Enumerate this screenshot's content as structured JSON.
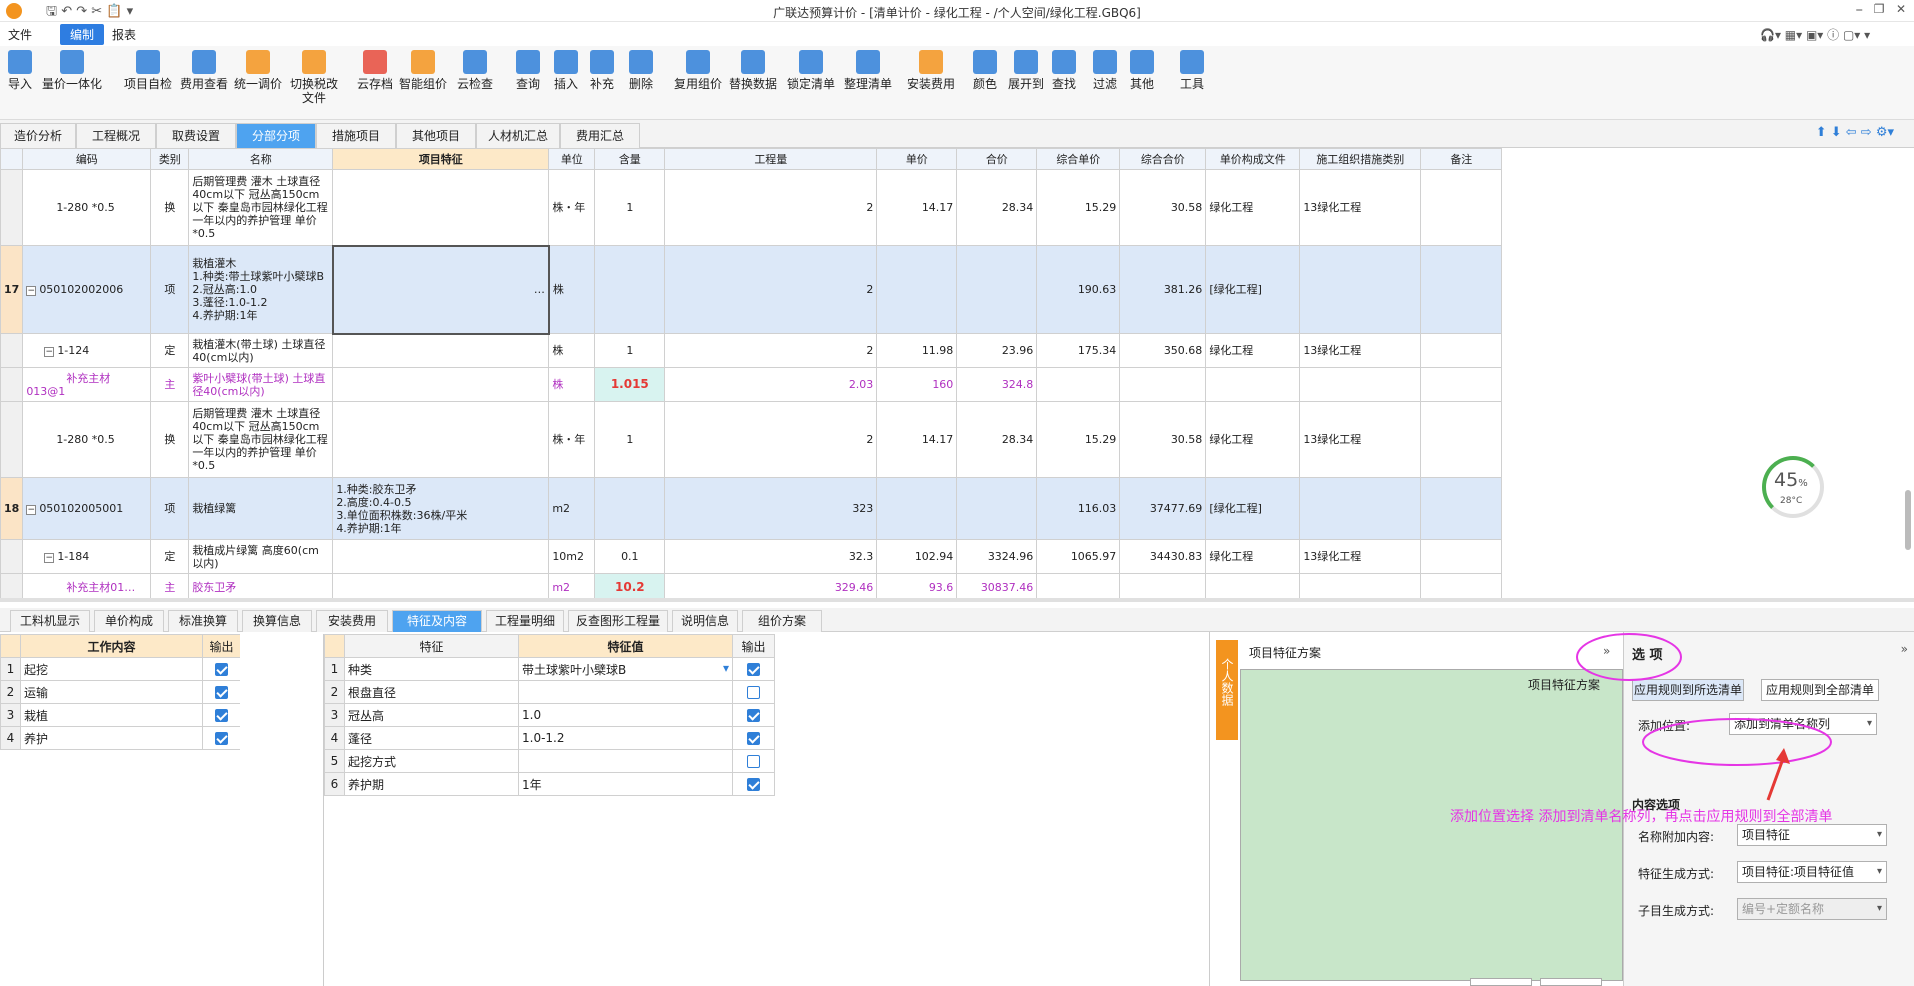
{
  "app": {
    "title": "广联达预算计价 - [清单计价 - 绿化工程 - /个人空间/绿化工程.GBQ6]"
  },
  "menu": {
    "file": "文件",
    "edit": "编制",
    "report": "报表"
  },
  "ribbon": [
    {
      "label": "导入",
      "color": "#2f7fd8"
    },
    {
      "label": "量价一体化",
      "color": "#2f7fd8"
    },
    {
      "label": "项目自检",
      "color": "#2f7fd8"
    },
    {
      "label": "费用查看",
      "color": "#2f7fd8"
    },
    {
      "label": "统一调价",
      "color": "#f3941f"
    },
    {
      "label": "切换税改\n文件",
      "color": "#f3941f"
    },
    {
      "label": "云存档",
      "color": "#e64a3b"
    },
    {
      "label": "智能组价",
      "color": "#f3941f"
    },
    {
      "label": "云检查",
      "color": "#2f7fd8"
    },
    {
      "label": "查询",
      "color": "#2f7fd8"
    },
    {
      "label": "插入",
      "color": "#2f7fd8"
    },
    {
      "label": "补充",
      "color": "#2f7fd8"
    },
    {
      "label": "删除",
      "color": "#2f7fd8"
    },
    {
      "label": "复用组价",
      "color": "#2f7fd8"
    },
    {
      "label": "替换数据",
      "color": "#2f7fd8"
    },
    {
      "label": "锁定清单",
      "color": "#2f7fd8"
    },
    {
      "label": "整理清单",
      "color": "#2f7fd8"
    },
    {
      "label": "安装费用",
      "color": "#f3941f"
    },
    {
      "label": "颜色",
      "color": "#2f7fd8"
    },
    {
      "label": "展开到",
      "color": "#2f7fd8"
    },
    {
      "label": "查找",
      "color": "#2f7fd8"
    },
    {
      "label": "过滤",
      "color": "#2f7fd8"
    },
    {
      "label": "其他",
      "color": "#2f7fd8"
    },
    {
      "label": "工具",
      "color": "#2f7fd8"
    }
  ],
  "tabs": [
    "造价分析",
    "工程概况",
    "取费设置",
    "分部分项",
    "措施项目",
    "其他项目",
    "人材机汇总",
    "费用汇总"
  ],
  "table": {
    "headers": [
      "编码",
      "类别",
      "名称",
      "项目特征",
      "单位",
      "含量",
      "工程量",
      "单价",
      "合价",
      "综合单价",
      "综合合价",
      "单价构成文件",
      "施工组织措施类别",
      "备注"
    ],
    "rows": [
      {
        "num": "",
        "code": "1-280 *0.5",
        "type": "换",
        "name": "后期管理费 灌木 土球直径40cm以下 冠丛高150cm以下  秦皇岛市园林绿化工程一年以内的养护管理 单价*0.5",
        "feat": "",
        "unit": "株・年",
        "content": "1",
        "qty": "2",
        "price": "14.17",
        "total": "28.34",
        "uprice": "15.29",
        "utotal": "30.58",
        "file": "绿化工程",
        "cat": "13绿化工程",
        "cls": "",
        "lvl": 2
      },
      {
        "num": "17",
        "code": "050102002006",
        "type": "项",
        "name": "栽植灌木\n1.种类:带土球紫叶小檗球B\n2.冠丛高:1.0\n3.蓬径:1.0-1.2\n4.养护期:1年",
        "feat": "…",
        "unit": "株",
        "content": "",
        "qty": "2",
        "price": "",
        "total": "",
        "uprice": "190.63",
        "utotal": "381.26",
        "file": "[绿化工程]",
        "cat": "",
        "cls": "sel",
        "lvl": 0
      },
      {
        "num": "",
        "code": "1-124",
        "type": "定",
        "name": "栽植灌木(带土球) 土球直径40(cm以内)",
        "feat": "",
        "unit": "株",
        "content": "1",
        "qty": "2",
        "price": "11.98",
        "total": "23.96",
        "uprice": "175.34",
        "utotal": "350.68",
        "file": "绿化工程",
        "cat": "13绿化工程",
        "cls": "",
        "lvl": 1
      },
      {
        "num": "",
        "code": "补充主材013@1",
        "type": "主",
        "name": "紫叶小檗球(带土球) 土球直径40(cm以内)",
        "feat": "",
        "unit": "株",
        "content": "1.015",
        "qty": "2.03",
        "price": "160",
        "total": "324.8",
        "uprice": "",
        "utotal": "",
        "file": "",
        "cat": "",
        "cls": "mat",
        "lvl": 3
      },
      {
        "num": "",
        "code": "1-280 *0.5",
        "type": "换",
        "name": "后期管理费 灌木 土球直径40cm以下 冠丛高150cm以下  秦皇岛市园林绿化工程一年以内的养护管理 单价*0.5",
        "feat": "",
        "unit": "株・年",
        "content": "1",
        "qty": "2",
        "price": "14.17",
        "total": "28.34",
        "uprice": "15.29",
        "utotal": "30.58",
        "file": "绿化工程",
        "cat": "13绿化工程",
        "cls": "",
        "lvl": 2
      },
      {
        "num": "18",
        "code": "050102005001",
        "type": "项",
        "name": "栽植绿篱",
        "feat": "1.种类:胶东卫矛\n2.高度:0.4-0.5\n3.单位面积株数:36株/平米\n4.养护期:1年",
        "unit": "m2",
        "content": "",
        "qty": "323",
        "price": "",
        "total": "",
        "uprice": "116.03",
        "utotal": "37477.69",
        "file": "[绿化工程]",
        "cat": "",
        "cls": "sel",
        "lvl": 0
      },
      {
        "num": "",
        "code": "1-184",
        "type": "定",
        "name": "栽植成片绿篱 高度60(cm以内)",
        "feat": "",
        "unit": "10m2",
        "content": "0.1",
        "qty": "32.3",
        "price": "102.94",
        "total": "3324.96",
        "uprice": "1065.97",
        "utotal": "34430.83",
        "file": "绿化工程",
        "cat": "13绿化工程",
        "cls": "",
        "lvl": 1
      },
      {
        "num": "",
        "code": "补充主材01…",
        "type": "主",
        "name": "胶东卫矛",
        "feat": "",
        "unit": "m2",
        "content": "10.2",
        "qty": "329.46",
        "price": "93.6",
        "total": "30837.46",
        "uprice": "",
        "utotal": "",
        "file": "",
        "cat": "",
        "cls": "mat",
        "lvl": 3
      }
    ]
  },
  "bottom_tabs": [
    "工料机显示",
    "单价构成",
    "标准换算",
    "换算信息",
    "安装费用",
    "特征及内容",
    "工程量明细",
    "反查图形工程量",
    "说明信息",
    "组价方案"
  ],
  "work": {
    "header": "工作内容",
    "out": "输出",
    "items": [
      {
        "n": "1",
        "t": "起挖",
        "on": true
      },
      {
        "n": "2",
        "t": "运输",
        "on": true
      },
      {
        "n": "3",
        "t": "栽植",
        "on": true
      },
      {
        "n": "4",
        "t": "养护",
        "on": true
      }
    ]
  },
  "features": {
    "h1": "特征",
    "h2": "特征值",
    "h3": "输出",
    "items": [
      {
        "n": "1",
        "k": "种类",
        "v": "带土球紫叶小檗球B",
        "on": true
      },
      {
        "n": "2",
        "k": "根盘直径",
        "v": "",
        "on": false
      },
      {
        "n": "3",
        "k": "冠丛高",
        "v": "1.0",
        "on": true
      },
      {
        "n": "4",
        "k": "蓬径",
        "v": "1.0-1.2",
        "on": true
      },
      {
        "n": "5",
        "k": "起挖方式",
        "v": "",
        "on": false
      },
      {
        "n": "6",
        "k": "养护期",
        "v": "1年",
        "on": true
      }
    ]
  },
  "scheme": {
    "title": "项目特征方案",
    "inner": "项目特征方案",
    "side": "个人数据"
  },
  "options": {
    "title": "选 项",
    "apply_sel": "应用规则到所选清单",
    "apply_all": "应用规则到全部清单",
    "pos_label": "添加位置:",
    "pos_val": "添加到清单名称列",
    "content_title": "内容选项",
    "name_label": "名称附加内容:",
    "name_val": "项目特征",
    "feat_label": "特征生成方式:",
    "feat_val": "项目特征:项目特征值",
    "sub_label": "子目生成方式:",
    "sub_val": "编号+定额名称"
  },
  "annotation": "添加位置选择  添加到清单名称列，再点击应用规则到全部清单",
  "widget": {
    "pct": "45",
    "pct_unit": "%",
    "temp": "28°C"
  }
}
